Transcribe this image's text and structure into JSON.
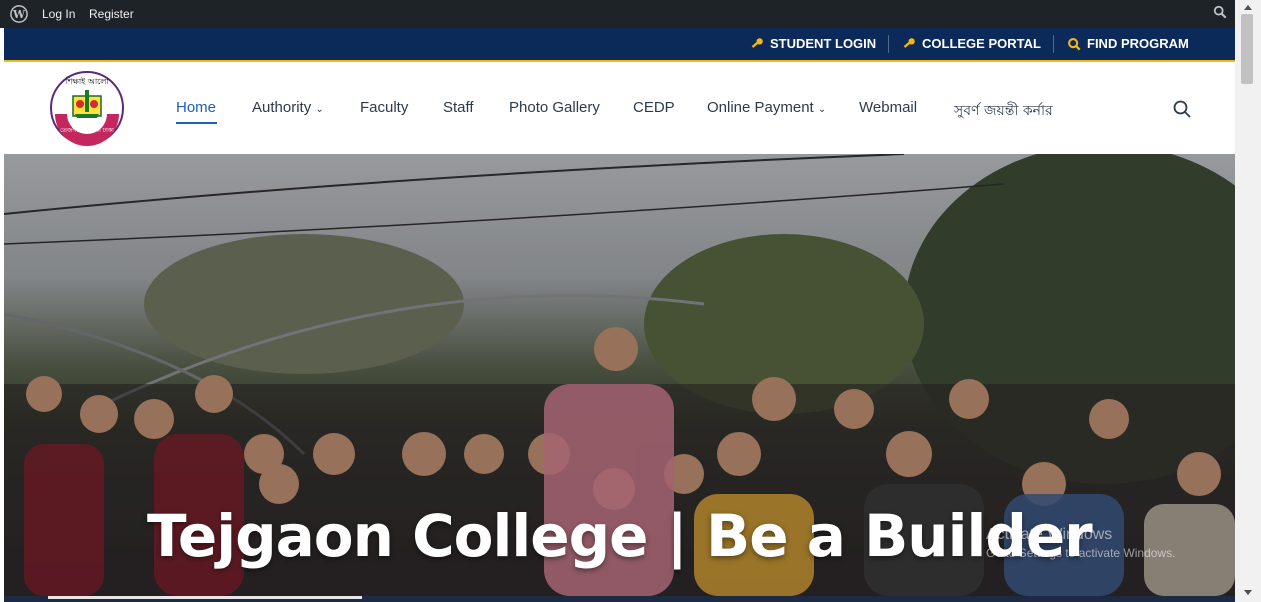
{
  "admin_bar": {
    "links": [
      "Log In",
      "Register"
    ],
    "icons": [
      "wordpress-icon",
      "search-icon"
    ]
  },
  "top_strip": {
    "links": [
      "STUDENT LOGIN",
      "COLLEGE PORTAL",
      "FIND PROGRAM"
    ],
    "accent": "#f3b814",
    "background": "#0b2a59"
  },
  "nav": {
    "items": [
      "Home",
      "Authority",
      "Faculty",
      "Staff",
      "Photo Gallery",
      "CEDP",
      "Online Payment",
      "Webmail",
      "সুবর্ণ জয়ন্তী কর্নার"
    ],
    "dropdown_items": [
      "Authority",
      "Online Payment"
    ],
    "active": "Home",
    "accent": "#1f5fb8"
  },
  "logo": {
    "top_text": "শিক্ষাই আলো",
    "bottom_text": "তেজগাঁও কলেজ ঢাকা"
  },
  "hero": {
    "title": "Tejgaon College | Be a Builder",
    "watermark_title": "Activate Windows",
    "watermark_sub": "Go to Settings to activate Windows."
  }
}
